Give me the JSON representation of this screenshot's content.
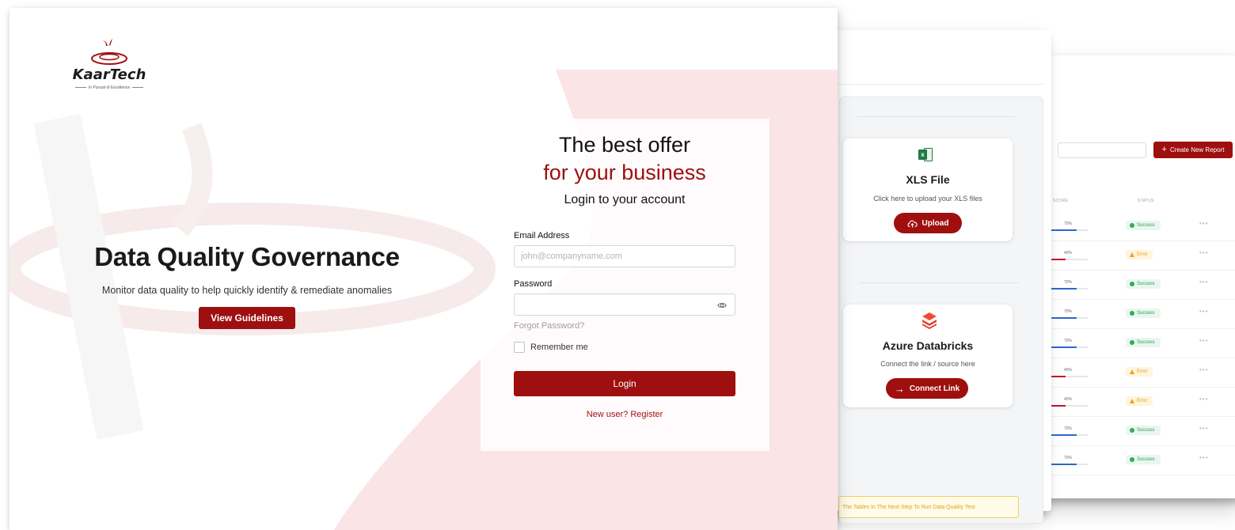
{
  "colors": {
    "brand": "#9e0f0f",
    "success": "#36a85d",
    "error": "#f0a020"
  },
  "report_panel": {
    "create_button_label": "Create New Report",
    "columns": [
      "SCORE",
      "STATUS"
    ],
    "rows": [
      {
        "score": "70%",
        "score_value": 0.7,
        "status": "Success",
        "status_type": "ok"
      },
      {
        "score": "40%",
        "score_value": 0.4,
        "status": "Error",
        "status_type": "err"
      },
      {
        "score": "70%",
        "score_value": 0.7,
        "status": "Success",
        "status_type": "ok"
      },
      {
        "score": "70%",
        "score_value": 0.7,
        "status": "Success",
        "status_type": "ok"
      },
      {
        "score": "70%",
        "score_value": 0.7,
        "status": "Success",
        "status_type": "ok"
      },
      {
        "score": "40%",
        "score_value": 0.4,
        "status": "Error",
        "status_type": "err"
      },
      {
        "score": "40%",
        "score_value": 0.4,
        "status": "Error",
        "status_type": "err"
      },
      {
        "score": "70%",
        "score_value": 0.7,
        "status": "Success",
        "status_type": "ok"
      },
      {
        "score": "70%",
        "score_value": 0.7,
        "status": "Success",
        "status_type": "ok"
      }
    ],
    "row_menu": "•••"
  },
  "source_panel": {
    "xls": {
      "icon": "excel-icon",
      "title": "XLS File",
      "subtitle": "Click here to upload your XLS files",
      "button_label": "Upload"
    },
    "databricks": {
      "icon": "databricks-layers-icon",
      "title": "Azure Databricks",
      "subtitle": "Connect the link / source here",
      "button_label": "Connect Link"
    },
    "notice": "The Tables In The Next Step To Run Data Quality Test"
  },
  "login_page": {
    "logo": {
      "name": "KaarTech",
      "tagline": "In Pursuit of Excellence"
    },
    "hero": {
      "title": "Data Quality Governance",
      "subtitle": "Monitor data quality to help quickly identify & remediate anomalies",
      "button_label": "View Guidelines"
    },
    "form": {
      "heading_1": "The best offer",
      "heading_2": "for your business",
      "heading_3": "Login to your account",
      "email_label": "Email Address",
      "email_placeholder": "john@companyname.com",
      "password_label": "Password",
      "forgot_label": "Forgot Password?",
      "remember_label": "Remember me",
      "login_button": "Login",
      "register_link": "New user? Register"
    }
  }
}
